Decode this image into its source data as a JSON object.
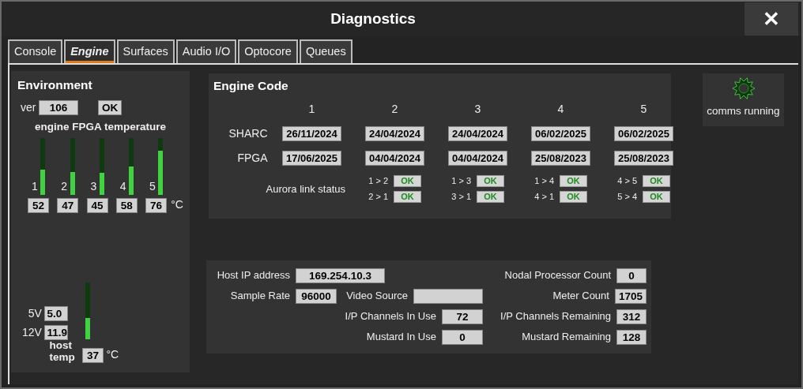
{
  "window": {
    "title": "Diagnostics",
    "close": "✕"
  },
  "tabs": [
    {
      "label": "Console",
      "selected": false
    },
    {
      "label": "Engine",
      "selected": true
    },
    {
      "label": "Surfaces",
      "selected": false
    },
    {
      "label": "Audio I/O",
      "selected": false
    },
    {
      "label": "Optocore",
      "selected": false
    },
    {
      "label": "Queues",
      "selected": false
    }
  ],
  "environment": {
    "title": "Environment",
    "version": {
      "label": "ver",
      "value": "106"
    },
    "status": "OK",
    "fpga_temperature": {
      "title": "engine FPGA temperature",
      "unit": "°C",
      "meters": [
        {
          "label": "1",
          "level": 0.45,
          "reading": "52"
        },
        {
          "label": "2",
          "level": 0.4,
          "reading": "47"
        },
        {
          "label": "3",
          "level": 0.39,
          "reading": "45"
        },
        {
          "label": "4",
          "level": 0.5,
          "reading": "58"
        },
        {
          "label": "5",
          "level": 0.78,
          "reading": "76"
        }
      ]
    },
    "voltages": [
      {
        "label": "5V",
        "value": "5.0"
      },
      {
        "label": "12V",
        "value": "11.9"
      }
    ],
    "host_temp": {
      "label": "host temp",
      "level": 0.38,
      "reading": "37",
      "unit": "°C"
    }
  },
  "engine_code": {
    "title": "Engine Code",
    "columns": [
      "1",
      "2",
      "3",
      "4",
      "5"
    ],
    "rows": [
      {
        "label": "SHARC",
        "values": [
          "26/11/2024",
          "24/04/2024",
          "24/04/2024",
          "06/02/2025",
          "06/02/2025"
        ]
      },
      {
        "label": "FPGA",
        "values": [
          "17/06/2025",
          "04/04/2024",
          "04/04/2024",
          "25/08/2023",
          "25/08/2023"
        ]
      }
    ],
    "aurora": {
      "label": "Aurora link status",
      "links": [
        [
          {
            "label": "1 > 2",
            "status": "OK"
          },
          {
            "label": "2 > 1",
            "status": "OK"
          }
        ],
        [
          {
            "label": "1 > 3",
            "status": "OK"
          },
          {
            "label": "3 > 1",
            "status": "OK"
          }
        ],
        [
          {
            "label": "1 > 4",
            "status": "OK"
          },
          {
            "label": "4 > 1",
            "status": "OK"
          }
        ],
        [
          {
            "label": "4 > 5",
            "status": "OK"
          },
          {
            "label": "5 > 4",
            "status": "OK"
          }
        ]
      ]
    }
  },
  "comms": {
    "label": "comms running"
  },
  "host": {
    "columns": [
      [
        {
          "label": "Host IP address",
          "value": "169.254.10.3"
        },
        {
          "label": "Sample Rate",
          "value": "96000"
        }
      ],
      [
        {
          "label": "Video Source"
        },
        {
          "label": "I/P Channels In Use",
          "value": "72"
        },
        {
          "label": "Mustard In Use",
          "value": "0"
        }
      ],
      [
        {
          "label": "Nodal Processor Count",
          "value": "0"
        },
        {
          "label": "Meter Count",
          "value": "1705"
        },
        {
          "label": "I/P Channels Remaining",
          "value": "312"
        },
        {
          "label": "Mustard Remaining",
          "value": "128"
        }
      ]
    ]
  }
}
